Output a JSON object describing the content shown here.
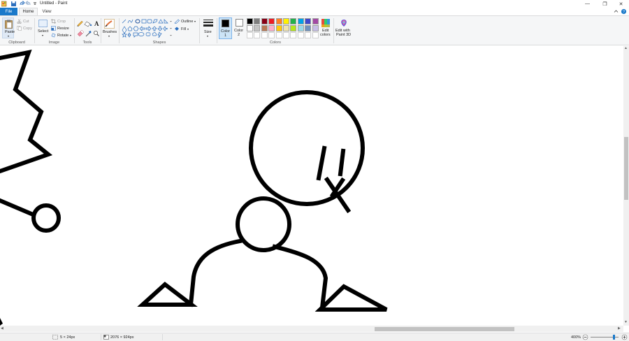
{
  "window": {
    "title": "Untitled - Paint",
    "minimize_glyph": "—",
    "maximize_glyph": "❐",
    "close_glyph": "✕"
  },
  "tabs": {
    "file": "File",
    "home": "Home",
    "view": "View"
  },
  "clipboard": {
    "paste": "Paste",
    "cut": "Cut",
    "copy": "Copy",
    "label": "Clipboard"
  },
  "image": {
    "select": "Select",
    "crop": "Crop",
    "resize": "Resize",
    "rotate": "Rotate",
    "label": "Image"
  },
  "tools": {
    "label": "Tools"
  },
  "brushes": {
    "label": "Brushes"
  },
  "shapes": {
    "outline": "Outline",
    "fill": "Fill",
    "label": "Shapes"
  },
  "size": {
    "label": "Size"
  },
  "colors": {
    "color1_label_a": "Color",
    "color1_label_b": "1",
    "color2_label_a": "Color",
    "color2_label_b": "2",
    "edit_colors_a": "Edit",
    "edit_colors_b": "colors",
    "paint3d_a": "Edit with",
    "paint3d_b": "Paint 3D",
    "label": "Colors",
    "color1": "#000000",
    "color2": "#ffffff",
    "palette_row1": [
      "#000000",
      "#7f7f7f",
      "#880015",
      "#ed1c24",
      "#ff7f27",
      "#fff200",
      "#22b14c",
      "#00a2e8",
      "#3f48cc",
      "#a349a4"
    ],
    "palette_row2": [
      "#ffffff",
      "#c3c3c3",
      "#b97a57",
      "#ffaec9",
      "#ffc90e",
      "#efe4b0",
      "#b5e61d",
      "#99d9ea",
      "#7092be",
      "#c8bfe7"
    ]
  },
  "status": {
    "selection_size": "5 × 24px",
    "canvas_size": "2076 × 924px",
    "zoom": "400%",
    "zoom_level": 0.86
  }
}
